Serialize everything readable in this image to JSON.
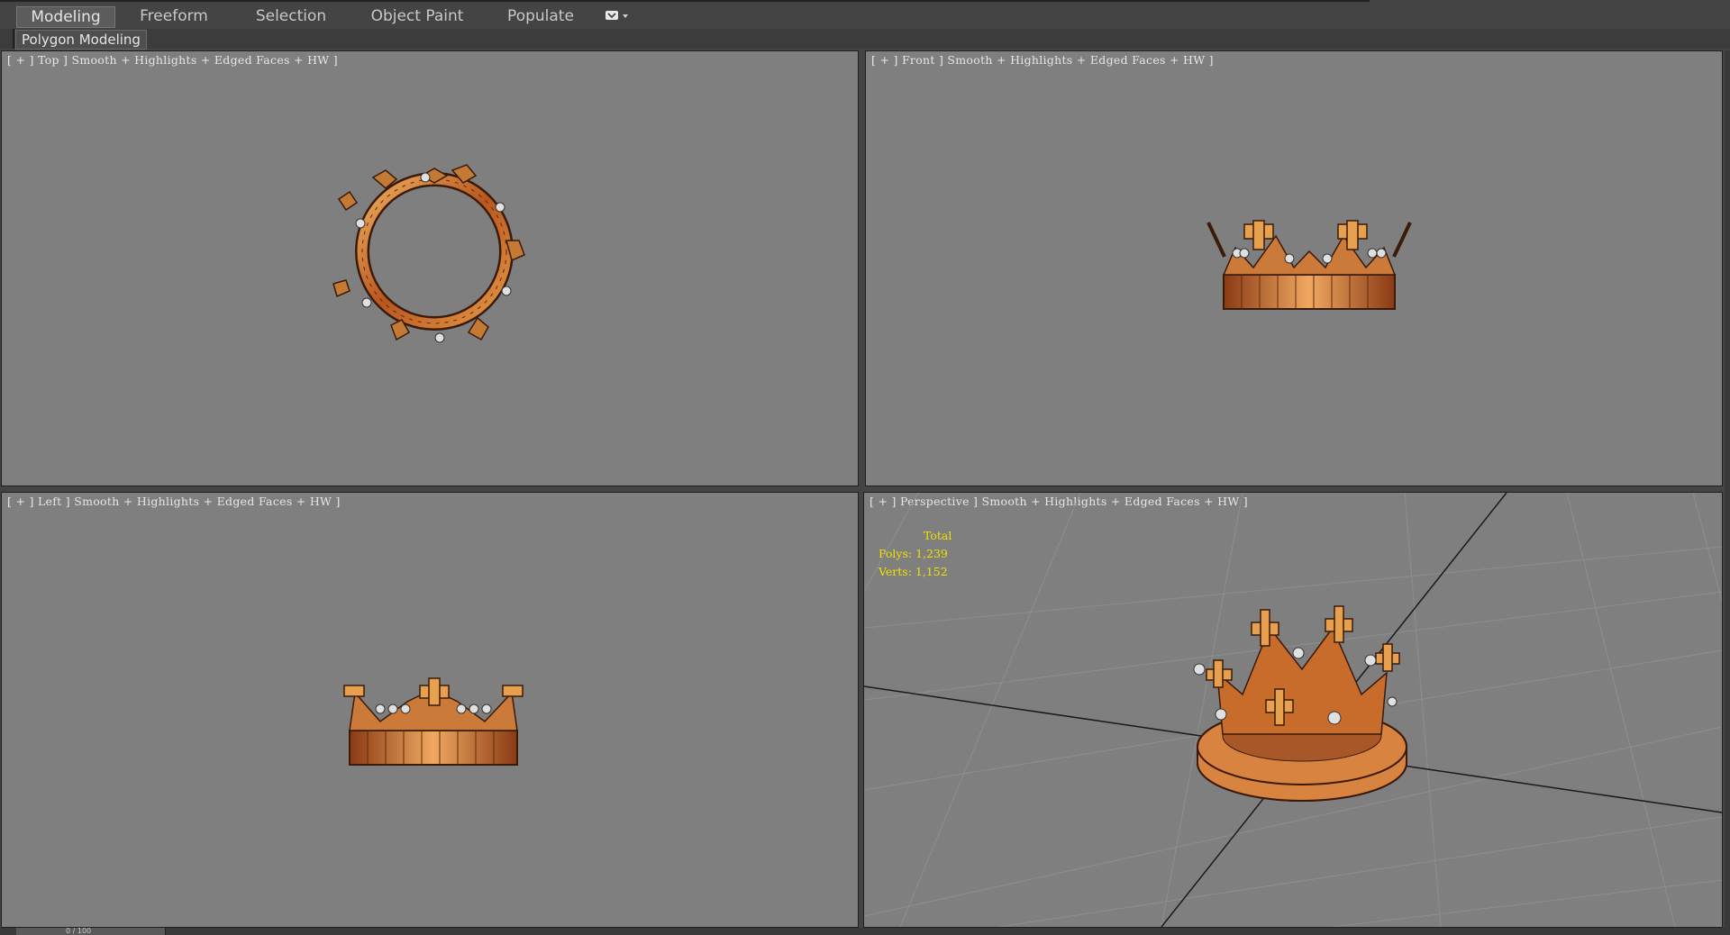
{
  "ribbon": {
    "tabs": [
      {
        "label": "Modeling",
        "active": true
      },
      {
        "label": "Freeform",
        "active": false
      },
      {
        "label": "Selection",
        "active": false
      },
      {
        "label": "Object Paint",
        "active": false
      },
      {
        "label": "Populate",
        "active": false
      }
    ],
    "dropdown_icon": "dropdown-menu-icon"
  },
  "subbar": {
    "label": "Polygon Modeling"
  },
  "viewports": {
    "top": {
      "label": "[ + ] Top ] Smooth + Highlights + Edged Faces + HW ]"
    },
    "front": {
      "label": "[ + ] Front ] Smooth + Highlights + Edged Faces + HW ]"
    },
    "left": {
      "label": "[ + ] Left ] Smooth + Highlights + Edged Faces + HW ]"
    },
    "perspective": {
      "label": "[ + ] Perspective ] Smooth + Highlights + Edged Faces + HW ]",
      "stats": {
        "total_label": "Total",
        "polys": "Polys: 1,239",
        "verts": "Verts: 1,152"
      }
    }
  },
  "bottombar": {
    "frame_counter": "0 / 100"
  },
  "colors": {
    "viewport_bg": "#7f7f7f",
    "stats_text": "#f2e000",
    "crown_gold": "#d9823c",
    "crown_dark": "#5a2a10"
  }
}
